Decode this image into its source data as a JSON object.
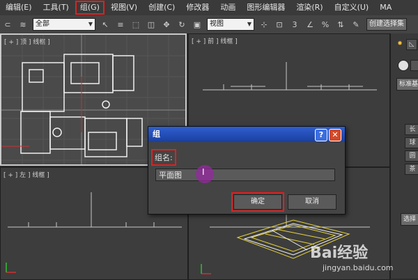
{
  "menu": [
    {
      "label": "编辑(E)",
      "highlight": false
    },
    {
      "label": "工具(T)",
      "highlight": false
    },
    {
      "label": "组(G)",
      "highlight": true
    },
    {
      "label": "视图(V)",
      "highlight": false
    },
    {
      "label": "创建(C)",
      "highlight": false
    },
    {
      "label": "修改器",
      "highlight": false
    },
    {
      "label": "动画",
      "highlight": false
    },
    {
      "label": "图形编辑器",
      "highlight": false
    },
    {
      "label": "渲染(R)",
      "highlight": false
    },
    {
      "label": "自定义(U)",
      "highlight": false
    },
    {
      "label": "MA",
      "highlight": false
    }
  ],
  "toolbar": {
    "selection_filter": "全部",
    "coord_system": "视图",
    "named_selection_placeholder": "创建选择集"
  },
  "viewports": {
    "top": "[ + ] 顶 ] 线框 ]",
    "front": "[ + ] 前 ] 线框 ]",
    "left": "[ + ] 左 ] 线框 ]"
  },
  "command_panel": {
    "standard_label": "标准基",
    "buttons": [
      "长",
      "球",
      "圆",
      "茶"
    ],
    "select_label": "选择"
  },
  "dialog": {
    "title": "组",
    "help_symbol": "?",
    "close_symbol": "✕",
    "group_name_label": "组名:",
    "group_name_value": "平面图",
    "ok_label": "确定",
    "cancel_label": "取消"
  },
  "watermark": {
    "logo": "Bai经验",
    "url": "jingyan.baidu.com"
  },
  "colors": {
    "highlight_red": "#e02020",
    "title_blue": "#2f5fd0"
  }
}
